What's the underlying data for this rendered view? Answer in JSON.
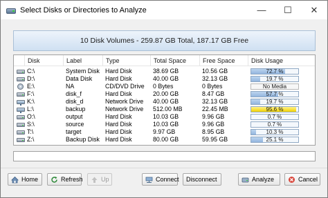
{
  "window": {
    "title": "Select Disks or Directories to Analyze",
    "controls": {
      "minimize": "—",
      "maximize": "☐",
      "close": "✕"
    }
  },
  "banner": {
    "text": "10 Disk Volumes - 259.87 GB Total, 187.17 GB Free"
  },
  "table": {
    "columns": [
      "Disk",
      "Label",
      "Type",
      "Total Space",
      "Free Space",
      "Disk Usage"
    ],
    "rows": [
      {
        "icon": "hard-disk",
        "disk": "C:\\",
        "label": "System Disk",
        "type": "Hard Disk",
        "total": "38.69 GB",
        "free": "10.56 GB",
        "usage_text": "72.7 %",
        "usage_pct": 72.7,
        "warn": false,
        "nomedia": false
      },
      {
        "icon": "hard-disk",
        "disk": "D:\\",
        "label": "Data Disk",
        "type": "Hard Disk",
        "total": "40.00 GB",
        "free": "32.13 GB",
        "usage_text": "19.7 %",
        "usage_pct": 19.7,
        "warn": false,
        "nomedia": false
      },
      {
        "icon": "cd-drive",
        "disk": "E:\\",
        "label": "NA",
        "type": "CD/DVD Drive",
        "total": "0 Bytes",
        "free": "0 Bytes",
        "usage_text": "No Media",
        "usage_pct": 0,
        "warn": false,
        "nomedia": true
      },
      {
        "icon": "hard-disk",
        "disk": "F:\\",
        "label": "disk_f",
        "type": "Hard Disk",
        "total": "20.00 GB",
        "free": "8.47 GB",
        "usage_text": "57.7 %",
        "usage_pct": 57.7,
        "warn": false,
        "nomedia": false
      },
      {
        "icon": "network-drive",
        "disk": "K:\\",
        "label": "disk_d",
        "type": "Network Drive",
        "total": "40.00 GB",
        "free": "32.13 GB",
        "usage_text": "19.7 %",
        "usage_pct": 19.7,
        "warn": false,
        "nomedia": false
      },
      {
        "icon": "network-drive",
        "disk": "L:\\",
        "label": "backup",
        "type": "Network Drive",
        "total": "512.00 MB",
        "free": "22.45 MB",
        "usage_text": "95.6 %",
        "usage_pct": 95.6,
        "warn": true,
        "nomedia": false
      },
      {
        "icon": "hard-disk",
        "disk": "O:\\",
        "label": "output",
        "type": "Hard Disk",
        "total": "10.03 GB",
        "free": "9.96 GB",
        "usage_text": "0.7 %",
        "usage_pct": 0.7,
        "warn": false,
        "nomedia": false
      },
      {
        "icon": "hard-disk",
        "disk": "S:\\",
        "label": "source",
        "type": "Hard Disk",
        "total": "10.03 GB",
        "free": "9.96 GB",
        "usage_text": "0.7 %",
        "usage_pct": 0.7,
        "warn": false,
        "nomedia": false
      },
      {
        "icon": "hard-disk",
        "disk": "T:\\",
        "label": "target",
        "type": "Hard Disk",
        "total": "9.97 GB",
        "free": "8.95 GB",
        "usage_text": "10.3 %",
        "usage_pct": 10.3,
        "warn": false,
        "nomedia": false
      },
      {
        "icon": "hard-disk",
        "disk": "Z:\\",
        "label": "Backup Disk",
        "type": "Hard Disk",
        "total": "80.00 GB",
        "free": "59.95 GB",
        "usage_text": "25.1 %",
        "usage_pct": 25.1,
        "warn": false,
        "nomedia": false
      }
    ]
  },
  "status_bar": {
    "text": ""
  },
  "buttons": {
    "home": "Home",
    "refresh": "Refresh",
    "up": "Up",
    "connect": "Connect",
    "disconnect": "Disconnect",
    "analyze": "Analyze",
    "cancel": "Cancel"
  },
  "colors": {
    "usage_fill": "#93b6df",
    "usage_warn": "#f1d100",
    "banner_bg": "#cfe0f2"
  }
}
